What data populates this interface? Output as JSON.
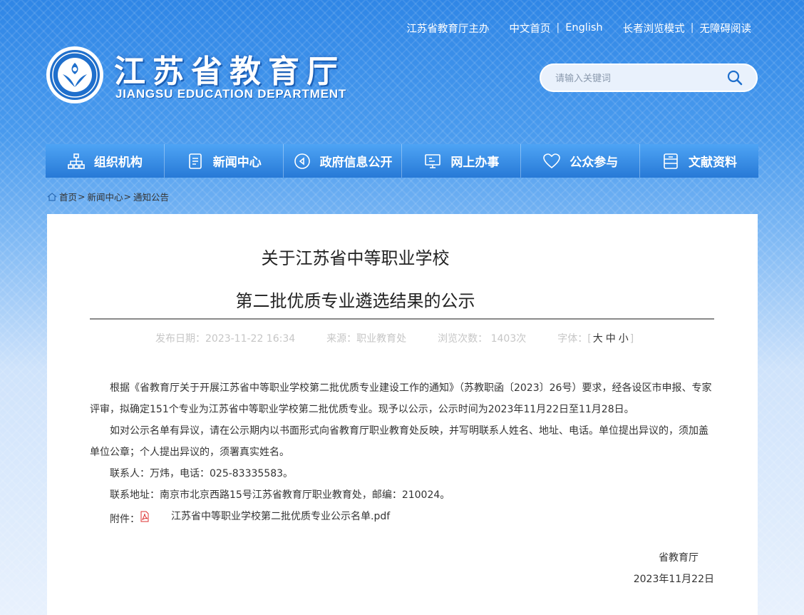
{
  "topbar": {
    "host": "江苏省教育厅主办",
    "home_cn": "中文首页",
    "english": "English",
    "elder_mode": "长者浏览模式",
    "accessible": "无障碍阅读"
  },
  "site": {
    "title": "江苏省教育厅",
    "subtitle": "JIANGSU EDUCATION DEPARTMENT"
  },
  "search": {
    "placeholder": "请输入关键词"
  },
  "nav": [
    {
      "label": "组织机构",
      "icon": "org-chart-icon"
    },
    {
      "label": "新闻中心",
      "icon": "document-icon"
    },
    {
      "label": "政府信息公开",
      "icon": "info-circle-icon"
    },
    {
      "label": "网上办事",
      "icon": "monitor-icon"
    },
    {
      "label": "公众参与",
      "icon": "heart-icon"
    },
    {
      "label": "文献资料",
      "icon": "archive-icon"
    }
  ],
  "breadcrumb": [
    "首页",
    "新闻中心",
    "通知公告"
  ],
  "article": {
    "title_line1": "关于江苏省中等职业学校",
    "title_line2": "第二批优质专业遴选结果的公示",
    "meta": {
      "date": "发布日期：2023-11-22 16:34",
      "source": "来源：职业教育处",
      "views": "浏览次数： 1403次",
      "font_label": "字体：",
      "font_big": "大",
      "font_mid": "中",
      "font_small": "小"
    },
    "paragraphs": [
      "根据《省教育厅关于开展江苏省中等职业学校第二批优质专业建设工作的通知》（苏教职函〔2023〕26号）要求，经各设区市申报、专家评审，拟确定151个专业为江苏省中等职业学校第二批优质专业。现予以公示，公示时间为2023年11月22日至11月28日。",
      "如对公示名单有异议，请在公示期内以书面形式向省教育厅职业教育处反映，并写明联系人姓名、地址、电话。单位提出异议的，须加盖单位公章；个人提出异议的，须署真实姓名。",
      "联系人：万炜，电话：025-83335583。",
      "联系地址：南京市北京西路15号江苏省教育厅职业教育处，邮编：210024。"
    ],
    "attachment_label": "附件：",
    "attachment_name": "江苏省中等职业学校第二批优质专业公示名单.pdf",
    "signature": "省教育厅",
    "sign_date": "2023年11月22日"
  },
  "colors": {
    "nav_blue": "#2f86e6",
    "header_blue": "#3a8eea"
  }
}
